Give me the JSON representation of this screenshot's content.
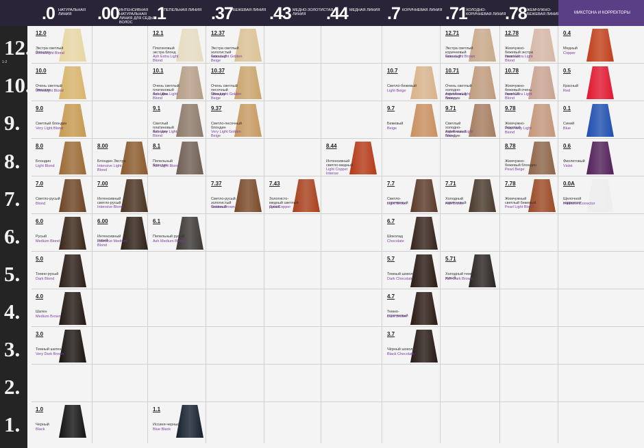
{
  "header": {
    "lines": [
      {
        "code": ".0",
        "name": "Натуральная линия"
      },
      {
        "code": ".00",
        "name": "Интенсивная натуральная линия для седых волос"
      },
      {
        "code": ".1",
        "name": "Пепельная линия"
      },
      {
        "code": ".37",
        "name": "Бежевая линия"
      },
      {
        "code": ".43",
        "name": "Медно-золотистая линия"
      },
      {
        "code": ".44",
        "name": "Медная линия"
      },
      {
        "code": ".7",
        "name": "Коричневая линия"
      },
      {
        "code": ".71",
        "name": "Холодно-коричневая линия"
      },
      {
        "code": ".78",
        "name": "Жемчужно-бежевая линия"
      }
    ],
    "mixtone": "Микстона и корректоры"
  },
  "scale_label": "1-2",
  "levels": [
    "12.",
    "10.",
    "9.",
    "8.",
    "7.",
    "6.",
    "5.",
    "4.",
    "3.",
    "2.",
    "1."
  ],
  "swatches": [
    {
      "code": "12.0",
      "ru": "Экстра светлый блондин",
      "en": "Extra Light Blond",
      "color": "#e8d7a4"
    },
    {
      "code": "12.1",
      "ru": "Платиновый экстра блонд",
      "en": "Ash Extra Light Blond",
      "color": "#e6dcc0"
    },
    {
      "code": "12.37",
      "ru": "Экстра светлый золотистый бежевый",
      "en": "Extra Light Golden Beige",
      "color": "#dcc295"
    },
    {
      "code": "12.71",
      "ru": "Экстра светлый коричневый бежевый",
      "en": "Extra Light Brown",
      "color": "#c9a98a"
    },
    {
      "code": "12.78",
      "ru": "Жемчужно-бежевый экстра светлый",
      "en": "Pearl Extra Light Blond",
      "color": "#d6b7a6"
    },
    {
      "code": "0.4",
      "ru": "Медный",
      "en": "Copper",
      "color": "#c23f1a"
    },
    {
      "code": "10.0",
      "ru": "Очень светлый блондин",
      "en": "Ultra Light Blond",
      "color": "#d9b46c"
    },
    {
      "code": "10.1",
      "ru": "Очень светлый платиновый блондин",
      "en": "Ash Ultra Light Blond",
      "color": "#b59e86"
    },
    {
      "code": "10.37",
      "ru": "Очень светлый песочный блондин",
      "en": "Ultra Light Golden Beige",
      "color": "#caa56d"
    },
    {
      "code": "10.7",
      "ru": "Светло-бежевый",
      "en": "Light Beige",
      "color": "#d9b38b"
    },
    {
      "code": "10.71",
      "ru": "Очень светлый холодно-коричневый блондин",
      "en": "Ash Ultra Light Brown",
      "color": "#bf9b7d"
    },
    {
      "code": "10.78",
      "ru": "Жемчужно-бежевый очень светлый",
      "en": "Pearl Ultra Light Blond",
      "color": "#c9a391"
    },
    {
      "code": "0.5",
      "ru": "Красный",
      "en": "Red",
      "color": "#e01830"
    },
    {
      "code": "9.0",
      "ru": "Светлый блондин",
      "en": "Very Light Blond",
      "color": "#c79a50"
    },
    {
      "code": "9.1",
      "ru": "Светлый платиновый блондин",
      "en": "Ash Very Light Blond",
      "color": "#8d7b6a"
    },
    {
      "code": "9.37",
      "ru": "Светло-песочный блондин",
      "en": "Very Light Golden Beige",
      "color": "#c89a62"
    },
    {
      "code": "9.7",
      "ru": "Бежевый",
      "en": "Beige",
      "color": "#c98f5f"
    },
    {
      "code": "9.71",
      "ru": "Светлый холодно-коричневый блондин",
      "en": "Ash Brown Light Blond",
      "color": "#a67d60"
    },
    {
      "code": "9.78",
      "ru": "Жемчужно-бежевый",
      "en": "Pearl Very Light Blond",
      "color": "#c4977a"
    },
    {
      "code": "0.1",
      "ru": "Синий",
      "en": "Blue",
      "color": "#1f4fb0"
    },
    {
      "code": "8.0",
      "ru": "Блондин",
      "en": "Light Blond",
      "color": "#9c6b34"
    },
    {
      "code": "8.00",
      "ru": "Блондин Экстра",
      "en": "Intensive Light Blond",
      "color": "#8a5a2c"
    },
    {
      "code": "8.1",
      "ru": "Пепельный блондин",
      "en": "Ash Light Blond",
      "color": "#6f5f52"
    },
    {
      "code": "8.44",
      "ru": "Интенсивный светло-медный",
      "en": "Light Copper Intense",
      "color": "#b53a16"
    },
    {
      "code": "8.78",
      "ru": "Жемчужно-бежевый блондин",
      "en": "Pearl Beige",
      "color": "#8e6548"
    },
    {
      "code": "0.6",
      "ru": "Фиолетовый",
      "en": "Violet",
      "color": "#52205a"
    },
    {
      "code": "7.0",
      "ru": "Светло-русый",
      "en": "Blond",
      "color": "#6d4424"
    },
    {
      "code": "7.00",
      "ru": "Интенсивный светло-русый",
      "en": "Intensive Blond",
      "color": "#4a3220"
    },
    {
      "code": "7.37",
      "ru": "Светло-русый золотистый бежевый",
      "en": "Golden Brown",
      "color": "#7a4a28"
    },
    {
      "code": "7.43",
      "ru": "Золотисто-медный светлый русый",
      "en": "Gold Copper",
      "color": "#a8401c"
    },
    {
      "code": "7.7",
      "ru": "Светло-коричневый",
      "en": "Light Brown",
      "color": "#5a3a28"
    },
    {
      "code": "7.71",
      "ru": "Холодный коричневый",
      "en": "Ash Brown",
      "color": "#4a3a2c"
    },
    {
      "code": "7.78",
      "ru": "Жемчужный светлый бежевый",
      "en": "Pearl Light Blond",
      "color": "#9b4a24"
    },
    {
      "code": "0.0A",
      "ru": "Щелочной корректор",
      "en": "Intensive Corrector",
      "color": "#eeeeee"
    },
    {
      "code": "6.0",
      "ru": "Русый",
      "en": "Medium Blond",
      "color": "#3a2618"
    },
    {
      "code": "6.00",
      "ru": "Интенсивный русый",
      "en": "Intensive Medium Blond",
      "color": "#2e2016"
    },
    {
      "code": "6.1",
      "ru": "Пепельный русый",
      "en": "Ash Medium Blond",
      "color": "#3c3834"
    },
    {
      "code": "6.7",
      "ru": "Шоколад",
      "en": "Chocolate",
      "color": "#35231a"
    },
    {
      "code": "5.0",
      "ru": "Темно-русый",
      "en": "Dark Blond",
      "color": "#2b1e16"
    },
    {
      "code": "5.7",
      "ru": "Темный шоколад",
      "en": "Dark Chocolate",
      "color": "#2a1b14"
    },
    {
      "code": "5.71",
      "ru": "Холодный темно-русый",
      "en": "Ash Dark Brown",
      "color": "#2a2420"
    },
    {
      "code": "4.0",
      "ru": "Шатен",
      "en": "Medium Brown",
      "color": "#241914"
    },
    {
      "code": "4.7",
      "ru": "Темно-коричневый",
      "en": "Dark Brown",
      "color": "#2c1a14"
    },
    {
      "code": "3.0",
      "ru": "Темный шатен",
      "en": "Very Dark Brown",
      "color": "#1c1612"
    },
    {
      "code": "3.7",
      "ru": "Чёрный шоколад",
      "en": "Black Chocolate",
      "color": "#261a15"
    },
    {
      "code": "1.0",
      "ru": "Черный",
      "en": "Black",
      "color": "#141414"
    },
    {
      "code": "1.1",
      "ru": "Иссиня-черный",
      "en": "Blue Black",
      "color": "#16202e"
    }
  ]
}
